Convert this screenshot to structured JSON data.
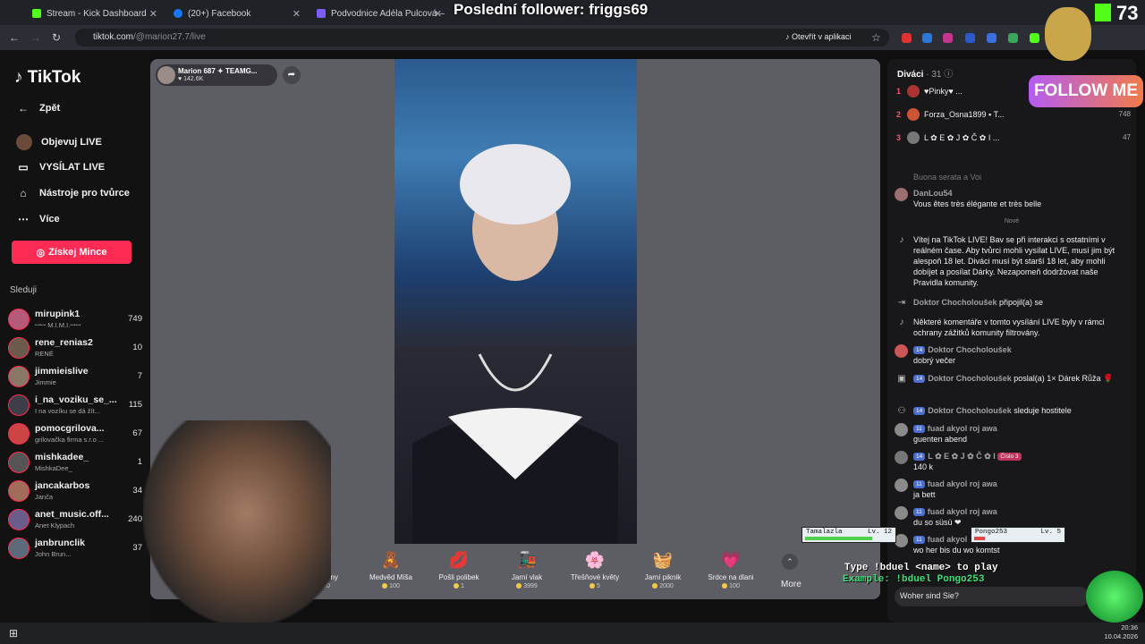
{
  "overlay_title": "Poslední follower: friggs69",
  "tabs": [
    {
      "label": "Stream - Kick Dashboard",
      "color": "#53fc18"
    },
    {
      "label": "(20+) Facebook",
      "color": "#1877f2"
    },
    {
      "label": "Podvodnice Adéla Pulcová – sh",
      "color": "#7a5cff"
    }
  ],
  "address": {
    "host": "tiktok.com",
    "path": "/@marion27.7/live",
    "open_app": "Otevřít v aplikaci"
  },
  "sidebar": {
    "logo": "TikTok",
    "back": "Zpět",
    "links": [
      "Objevuj LIVE",
      "VYSÍLAT LIVE",
      "Nástroje pro tvůrce",
      "Více"
    ],
    "coins_button": "Získej Mince",
    "following_title": "Sleduji",
    "following": [
      {
        "name": "mirupink1",
        "sub": "ꟷꟷ M.I.M.I.ꟷꟷ",
        "count": "749",
        "color": "#b65a7a"
      },
      {
        "name": "rene_renias2",
        "sub": "RENÉ",
        "count": "10",
        "color": "#6a5b4c"
      },
      {
        "name": "jimmieislive",
        "sub": "Jimmie",
        "count": "7",
        "color": "#8b7766"
      },
      {
        "name": "i_na_voziku_se_...",
        "sub": "I na vozíku se dá žít...",
        "count": "115",
        "color": "#3e3e48"
      },
      {
        "name": "pomocgrilova...",
        "sub": "grilovačka firma s.r.o ...",
        "count": "67",
        "color": "#c44"
      },
      {
        "name": "mishkadee_",
        "sub": "MishkaDee_",
        "count": "1",
        "color": "#555"
      },
      {
        "name": "jancakarbos",
        "sub": "Janča",
        "count": "34",
        "color": "#a06d5a"
      },
      {
        "name": "anet_music.off...",
        "sub": "Anet Klypach",
        "count": "240",
        "color": "#6b5d8a"
      },
      {
        "name": "janbrunclik",
        "sub": "John Brun...",
        "count": "37",
        "color": "#5b6b7a"
      }
    ]
  },
  "stage": {
    "host_name": "Marion 687 ✦ TEAMG...",
    "host_likes": "142.6K"
  },
  "gifts": [
    {
      "name": "S Květiny",
      "price": "20",
      "icon": "🌹"
    },
    {
      "name": "Medvěd Míša",
      "price": "100",
      "icon": "🧸"
    },
    {
      "name": "Pošli polibek",
      "price": "1",
      "icon": "💋"
    },
    {
      "name": "Jarní vlak",
      "price": "3999",
      "icon": "🚂"
    },
    {
      "name": "Třešňové květy",
      "price": "5",
      "icon": "🌸"
    },
    {
      "name": "Jarní piknik",
      "price": "2000",
      "icon": "🧺"
    },
    {
      "name": "Srdce na dlani",
      "price": "100",
      "icon": "💗"
    }
  ],
  "more_label": "More",
  "chat": {
    "viewers_label": "Diváci",
    "viewers_count": "· 31",
    "top": [
      {
        "rank": "1",
        "name": "♥Pinky♥ ...",
        "score": "",
        "color": "#a33"
      },
      {
        "rank": "2",
        "name": "Forza_Osna1899 ▪ T...",
        "score": "748",
        "color": "#c53"
      },
      {
        "rank": "3",
        "name": "L ✿ E ✿ J ✿ Č ✿ I ...",
        "score": "47",
        "color": "#777"
      }
    ],
    "pinned_fade": "Buona serata a Voi",
    "messages": [
      {
        "name": "DanLou54",
        "text": "Vous êtes très élégante et très belle"
      },
      {
        "divider": "Nové"
      },
      {
        "system": "Vítej na TikTok LIVE! Bav se při interakci s ostatními v reálném čase. Aby tvůrci mohli vysílat LIVE, musí jim být alespoň 18 let. Diváci musí být starší 18 let, aby mohli dobíjet a posílat Dárky. Nezapomeň dodržovat naše Pravidla komunity."
      },
      {
        "join_name": "Doktor Chocholoušek",
        "join_text": "připojil(a) se"
      },
      {
        "system": "Některé komentáře v tomto vysílání LIVE byly v rámci ochrany zážitků komunity filtrovány."
      },
      {
        "level": "14",
        "name": "Doktor Chocholoušek",
        "text": "dobrý večer"
      },
      {
        "level": "14",
        "name": "Doktor Chocholoušek",
        "inline": "poslal(a) 1× Dárek Růža"
      },
      {
        "level": "14",
        "name": "Doktor Chocholoušek",
        "inline": "sleduje hostitele"
      },
      {
        "level": "11",
        "name": "fuad akyol roj awa",
        "text": "guenten abend"
      },
      {
        "level": "14",
        "name": "L ✿ E ✿ J ✿ Č ✿ I",
        "badge": "Číslo 3",
        "text": "140 k"
      },
      {
        "level": "11",
        "name": "fuad akyol roj awa",
        "text": "ja bett"
      },
      {
        "level": "11",
        "name": "fuad akyol roj awa",
        "text": "du so süsü ❤"
      },
      {
        "level": "11",
        "name": "fuad akyol",
        "text": "wo her bis du wo komtst"
      }
    ],
    "input_value": "Woher sind Sie?"
  },
  "overlays": {
    "follow_me": "FOLLOW ME",
    "kick_count": "73",
    "duel_cards": [
      {
        "name": "Tamalazla",
        "level": "Lv. 12",
        "hp": 0.75
      },
      {
        "name": "Pongo253",
        "level": "Lv. 5",
        "hp": 0.12
      }
    ],
    "duel_text": "Type !bduel <name> to play",
    "duel_example": "Example: !bduel Pongo253"
  },
  "clock": {
    "time": "20:36",
    "date": "10.04.2026"
  }
}
